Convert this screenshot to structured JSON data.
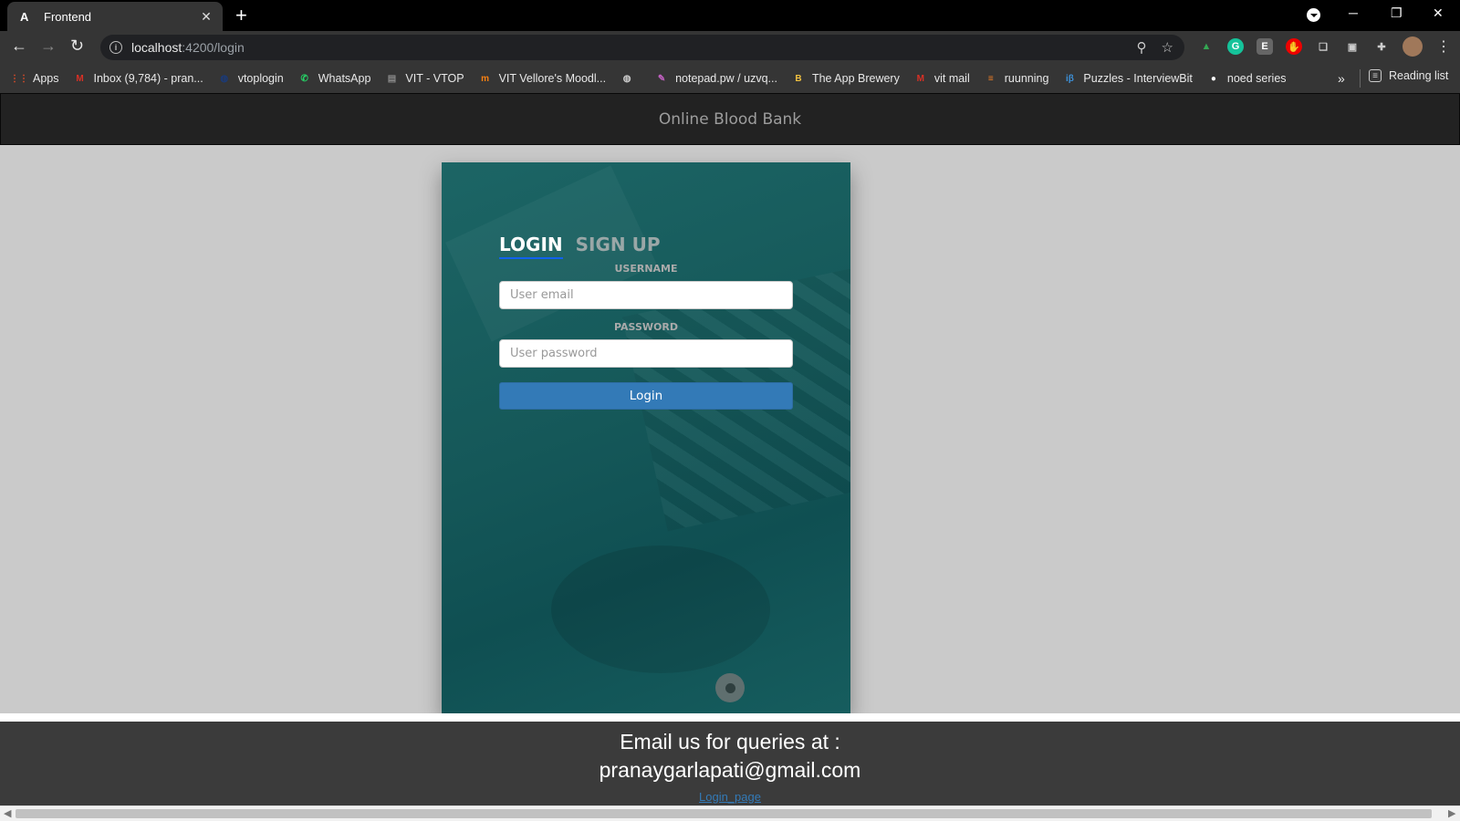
{
  "browser": {
    "tab_title": "Frontend",
    "tab_favicon": "A",
    "url_host": "localhost",
    "url_rest": ":4200/login"
  },
  "bookmarks": [
    {
      "label": "Apps",
      "icon": "apps-grid-icon",
      "color": "#e34c26"
    },
    {
      "label": "Inbox (9,784) - pran...",
      "icon": "gmail-icon",
      "color": "#d93025"
    },
    {
      "label": "vtoplogin",
      "icon": "globe-icon",
      "color": "#1a3a7a"
    },
    {
      "label": "WhatsApp",
      "icon": "whatsapp-icon",
      "color": "#25d366"
    },
    {
      "label": "VIT - VTOP",
      "icon": "vtop-icon",
      "color": "#888888"
    },
    {
      "label": "VIT Vellore's Moodl...",
      "icon": "moodle-icon",
      "color": "#f98012"
    },
    {
      "label": "",
      "icon": "globe-icon",
      "color": "#cccccc"
    },
    {
      "label": "notepad.pw / uzvq...",
      "icon": "notepad-icon",
      "color": "#c060c0"
    },
    {
      "label": "The App Brewery",
      "icon": "app-brewery-icon",
      "color": "#f0c040"
    },
    {
      "label": "vit mail",
      "icon": "gmail-icon",
      "color": "#d93025"
    },
    {
      "label": "ruunning",
      "icon": "stackoverflow-icon",
      "color": "#f48024"
    },
    {
      "label": "Puzzles - InterviewBit",
      "icon": "interviewbit-icon",
      "color": "#3d8fd6"
    },
    {
      "label": "noed series",
      "icon": "github-icon",
      "color": "#ffffff"
    }
  ],
  "reading_list": "Reading list",
  "app": {
    "brand": "Online Blood Bank",
    "tab_login": "LOGIN",
    "tab_signup": "SIGN UP",
    "username_label": "USERNAME",
    "username_placeholder": "User email",
    "password_label": "PASSWORD",
    "password_placeholder": "User password",
    "login_button": "Login"
  },
  "footer": {
    "line1": "Email us for queries at :",
    "line2": "pranaygarlapati@gmail.com",
    "link": "Login_page"
  }
}
